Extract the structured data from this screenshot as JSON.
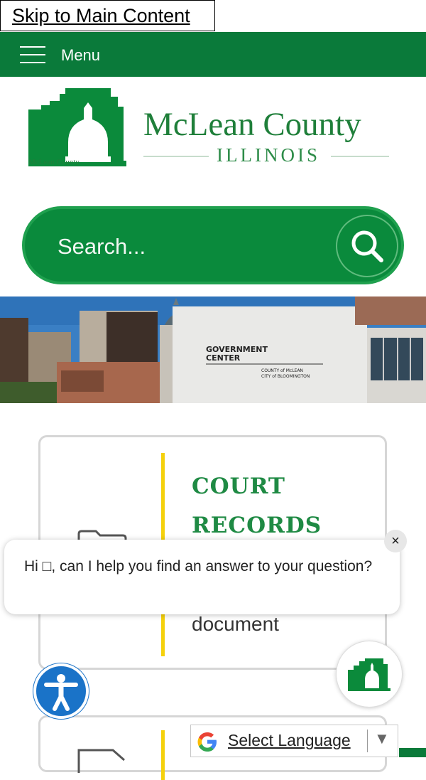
{
  "skip_link": "Skip to Main Content",
  "nav": {
    "menu_label": "Menu"
  },
  "logo": {
    "county_name": "McLean County",
    "state": "ILLINOIS",
    "mini_text": "McLean County"
  },
  "search": {
    "placeholder": "Search..."
  },
  "card": {
    "title": "COURT RECORDS",
    "description": "document"
  },
  "chat": {
    "message": "Hi □, can I help you find an answer to your question?",
    "close": "×"
  },
  "translate": {
    "label": "Select Language",
    "arrow": "▼"
  },
  "colors": {
    "brand_green": "#0a7a3a",
    "accent_yellow": "#f5d10c",
    "a11y_blue": "#1a73c8"
  },
  "icons": [
    "hamburger-icon",
    "search-icon",
    "folder-icon",
    "close-icon",
    "accessibility-icon",
    "google-icon",
    "dropdown-arrow-icon"
  ]
}
